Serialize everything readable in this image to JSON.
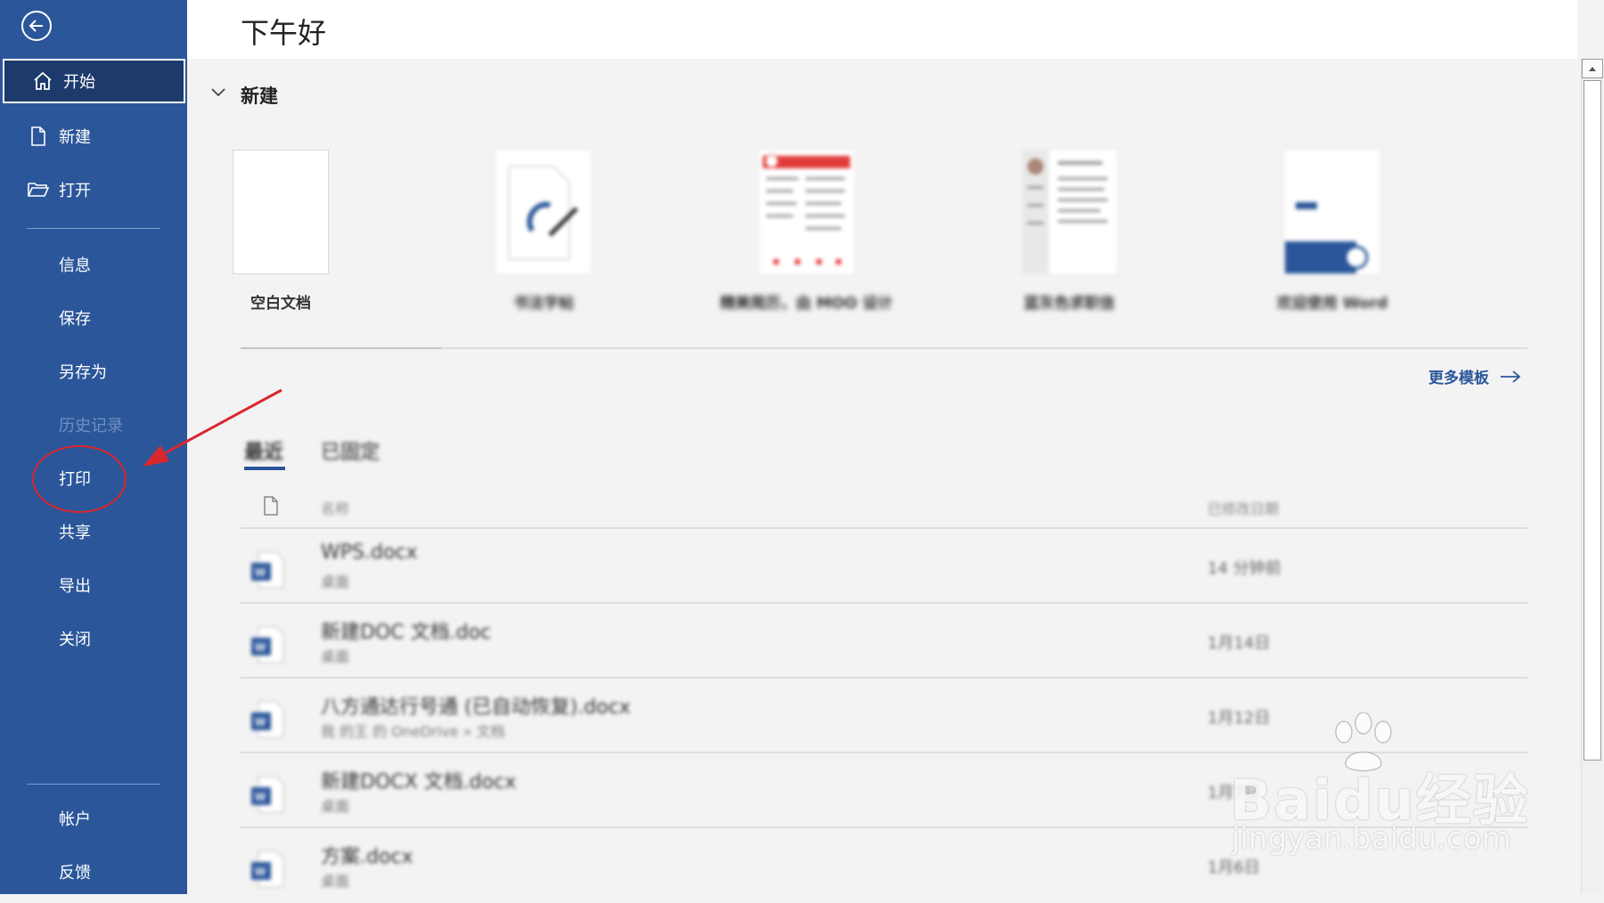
{
  "sidebar": {
    "back_icon": "back-arrow-icon",
    "items": [
      {
        "label": "开始",
        "icon": "home-icon",
        "active": true
      },
      {
        "label": "新建",
        "icon": "file-icon"
      },
      {
        "label": "打开",
        "icon": "folder-open-icon"
      },
      {
        "label": "信息"
      },
      {
        "label": "保存"
      },
      {
        "label": "另存为"
      },
      {
        "label": "历史记录",
        "disabled": true
      },
      {
        "label": "打印",
        "highlighted": true
      },
      {
        "label": "共享"
      },
      {
        "label": "导出"
      },
      {
        "label": "关闭"
      }
    ],
    "bottom_items": [
      {
        "label": "帐户"
      },
      {
        "label": "反馈"
      }
    ]
  },
  "main": {
    "greeting": "下午好",
    "new_section": {
      "title": "新建",
      "templates": [
        {
          "name": "空白文档"
        },
        {
          "name": "书法字帖"
        },
        {
          "name": "精美简历，由 MOO 设计"
        },
        {
          "name": "蓝灰色求职信"
        },
        {
          "name": "欢迎使用 Word"
        }
      ],
      "more_templates_label": "更多模板"
    },
    "tabs": [
      {
        "label": "最近",
        "active": true
      },
      {
        "label": "已固定"
      }
    ],
    "list_header": {
      "name": "名称",
      "date": "已修改日期"
    },
    "files": [
      {
        "name": "WPS.docx",
        "location": "桌面",
        "date": "14 分钟前"
      },
      {
        "name": "新建DOC 文档.doc",
        "location": "桌面",
        "date": "1月14日"
      },
      {
        "name": "八方通达行号通 (已自动恢复).docx",
        "location": "我 的王 的 OneDrive » 文档",
        "date": "1月12日"
      },
      {
        "name": "新建DOCX 文档.docx",
        "location": "桌面",
        "date": "1月7日"
      },
      {
        "name": "方案.docx",
        "location": "桌面",
        "date": "1月6日"
      }
    ]
  },
  "watermark": {
    "brand": "Baidu经验",
    "url": "jingyan.baidu.com"
  },
  "colors": {
    "sidebar": "#2b579a",
    "accent": "#2b579a",
    "annotation": "#d9272e"
  }
}
